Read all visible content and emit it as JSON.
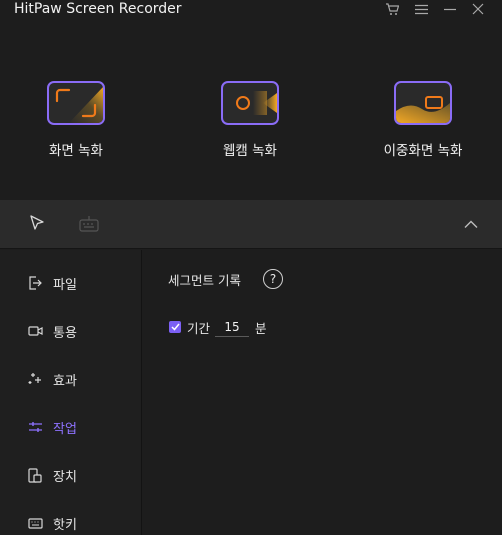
{
  "window": {
    "title": "HitPaw Screen Recorder"
  },
  "title_bar_icons": [
    "cart-icon",
    "menu-icon",
    "minimize-icon",
    "close-icon"
  ],
  "modes": [
    {
      "label": "화면 녹화",
      "icon": "screen-record-icon"
    },
    {
      "label": "웹캠 녹화",
      "icon": "webcam-record-icon"
    },
    {
      "label": "이중화면 녹화",
      "icon": "dual-screen-record-icon"
    }
  ],
  "toolstrip_icons": [
    "cursor-icon",
    "keyboard-icon",
    "chevron-up-icon"
  ],
  "sidebar": {
    "items": [
      {
        "label": "파일",
        "icon": "file-export-icon",
        "active": false
      },
      {
        "label": "통용",
        "icon": "video-camera-icon",
        "active": false
      },
      {
        "label": "효과",
        "icon": "sparkle-icon",
        "active": false
      },
      {
        "label": "작업",
        "icon": "sliders-icon",
        "active": true
      },
      {
        "label": "장치",
        "icon": "device-icon",
        "active": false
      },
      {
        "label": "핫키",
        "icon": "keyboard-icon",
        "active": false
      }
    ]
  },
  "content": {
    "segment_title": "세그먼트 기록",
    "help_glyph": "?",
    "duration_checked": true,
    "duration_label": "기간",
    "duration_value": "15",
    "duration_unit": "분"
  },
  "colors": {
    "accent": "#8a6cf6",
    "active_label": "#8e72ff",
    "orange": "#f0a020",
    "background": "#1d1d1d",
    "toolbar": "#2b2b2b"
  }
}
